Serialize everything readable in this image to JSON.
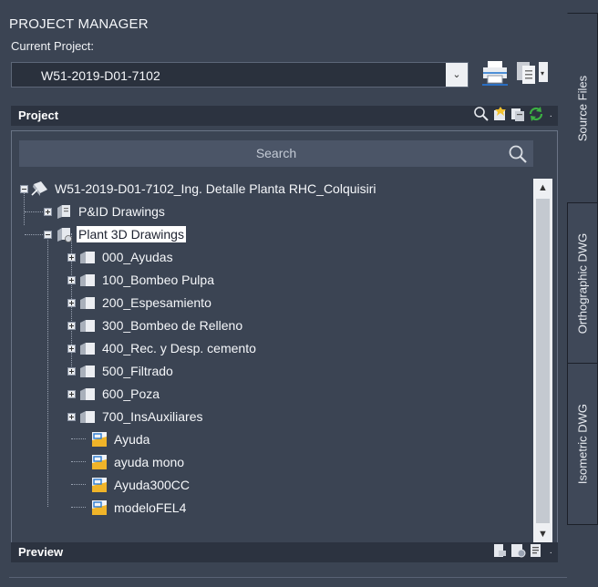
{
  "panel": {
    "title": "PROJECT MANAGER"
  },
  "current_project": {
    "label": "Current Project:",
    "value": "W51-2019-D01-7102"
  },
  "project_section": {
    "title": "Project"
  },
  "search": {
    "placeholder": "Search"
  },
  "tree": {
    "root": "W51-2019-D01-7102_Ing. Detalle Planta RHC_Colquisiri",
    "pid": "P&ID Drawings",
    "plant3d": "Plant 3D Drawings",
    "folders": [
      "000_Ayudas",
      "100_Bombeo Pulpa",
      "200_Espesamiento",
      "300_Bombeo de Relleno",
      "400_Rec. y Desp. cemento",
      "500_Filtrado",
      "600_Poza",
      "700_InsAuxiliares"
    ],
    "files": [
      "Ayuda",
      "ayuda mono",
      "Ayuda300CC",
      "modeloFEL4"
    ]
  },
  "preview_section": {
    "title": "Preview"
  },
  "side_tabs": [
    "Source Files",
    "Orthographic DWG",
    "Isometric DWG"
  ],
  "colors": {
    "panel_bg": "#3b4453",
    "header_bg": "#2c3340",
    "selection_bg": "#ffffff",
    "tree_text": "#f5f7fa",
    "refresh_green": "#3cb043"
  }
}
